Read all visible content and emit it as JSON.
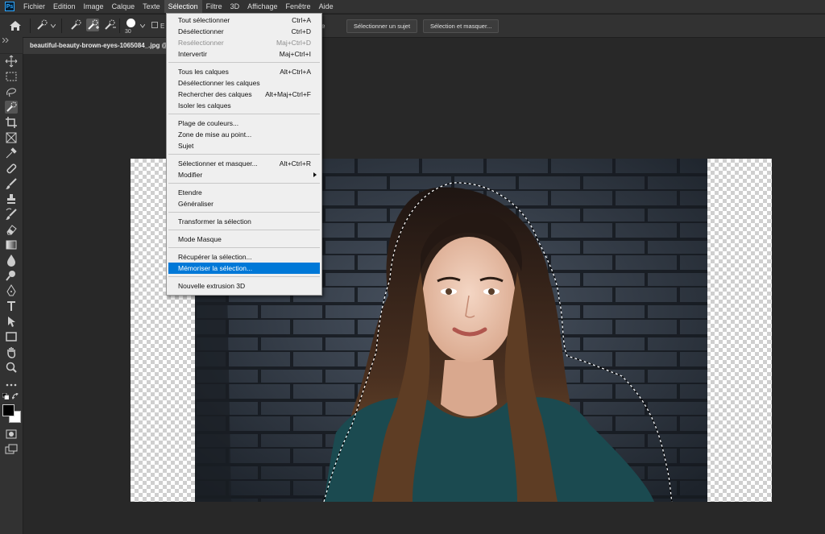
{
  "app": {
    "logo": "Ps"
  },
  "menubar": [
    "Fichier",
    "Edition",
    "Image",
    "Calque",
    "Texte",
    "Sélection",
    "Filtre",
    "3D",
    "Affichage",
    "Fenêtre",
    "Aide"
  ],
  "options": {
    "brush_size": "30",
    "partial_label": "E",
    "partial_label2": "e",
    "select_subject": "Sélectionner un sujet",
    "select_mask": "Sélection et masquer..."
  },
  "document": {
    "tab": "beautiful-beauty-brown-eyes-1065084_.jpg @"
  },
  "selection_menu": {
    "items": [
      {
        "label": "Tout sélectionner",
        "shortcut": "Ctrl+A"
      },
      {
        "label": "Désélectionner",
        "shortcut": "Ctrl+D"
      },
      {
        "label": "Resélectionner",
        "shortcut": "Maj+Ctrl+D",
        "disabled": true
      },
      {
        "label": "Intervertir",
        "shortcut": "Maj+Ctrl+I"
      },
      {
        "label": "Tous les calques",
        "shortcut": "Alt+Ctrl+A"
      },
      {
        "label": "Désélectionner les calques",
        "shortcut": ""
      },
      {
        "label": "Rechercher des calques",
        "shortcut": "Alt+Maj+Ctrl+F"
      },
      {
        "label": "Isoler les calques",
        "shortcut": ""
      },
      {
        "label": "Plage de couleurs...",
        "shortcut": ""
      },
      {
        "label": "Zone de mise au point...",
        "shortcut": ""
      },
      {
        "label": "Sujet",
        "shortcut": ""
      },
      {
        "label": "Sélectionner et masquer...",
        "shortcut": "Alt+Ctrl+R"
      },
      {
        "label": "Modifier",
        "shortcut": "",
        "submenu": true
      },
      {
        "label": "Etendre",
        "shortcut": ""
      },
      {
        "label": "Généraliser",
        "shortcut": ""
      },
      {
        "label": "Transformer la sélection",
        "shortcut": ""
      },
      {
        "label": "Mode Masque",
        "shortcut": ""
      },
      {
        "label": "Récupérer la sélection...",
        "shortcut": ""
      },
      {
        "label": "Mémoriser la sélection...",
        "shortcut": "",
        "highlighted": true
      },
      {
        "label": "Nouvelle extrusion 3D",
        "shortcut": ""
      }
    ]
  },
  "tools": [
    "move-icon",
    "marquee-icon",
    "lasso-icon",
    "quick-selection-icon",
    "crop-icon",
    "frame-icon",
    "eyedropper-icon",
    "healing-brush-icon",
    "brush-icon",
    "stamp-icon",
    "history-brush-icon",
    "eraser-icon",
    "gradient-icon",
    "blur-icon",
    "dodge-icon",
    "pen-icon",
    "type-icon",
    "path-selection-icon",
    "rectangle-icon",
    "hand-icon",
    "zoom-icon",
    "more-icon",
    "swap-colors-icon",
    "foreground-background-icon",
    "quick-mask-icon",
    "screen-mode-icon"
  ],
  "colors": {
    "accent": "#0078d7",
    "background": "#282828",
    "panel": "#323232"
  }
}
